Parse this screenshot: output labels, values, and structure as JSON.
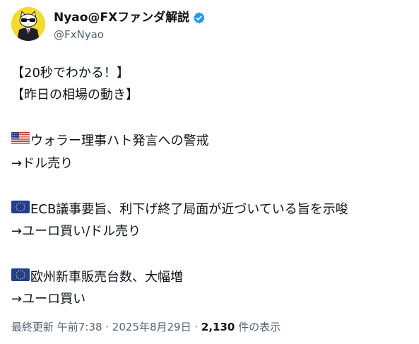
{
  "author": {
    "display_name": "Nyao@FXファンダ解説",
    "handle": "@FxNyao",
    "verified": true
  },
  "post_lines": [
    {
      "flag": "",
      "text": "【20秒でわかる！】"
    },
    {
      "flag": "",
      "text": "【昨日の相場の動き】"
    },
    {
      "flag": "",
      "text": ""
    },
    {
      "flag": "us-flag-icon",
      "text": "ウォラー理事ハト発言への警戒"
    },
    {
      "flag": "",
      "text": "→ドル売り"
    },
    {
      "flag": "",
      "text": ""
    },
    {
      "flag": "eu-flag-icon",
      "text": "ECB議事要旨、利下げ終了局面が近づいている旨を示唆"
    },
    {
      "flag": "",
      "text": "→ユーロ買い/ドル売り"
    },
    {
      "flag": "",
      "text": ""
    },
    {
      "flag": "eu-flag-icon",
      "text": "欧州新車販売台数、大幅増"
    },
    {
      "flag": "",
      "text": "→ユーロ買い"
    }
  ],
  "meta": {
    "updated_label": "最終更新",
    "time": "午前7:38",
    "sep1": " · ",
    "date": "2025年8月29日",
    "sep2": " · ",
    "views_count": "2,130",
    "views_label": " 件の表示"
  },
  "colors": {
    "verified_badge": "#1d9bf0",
    "secondary_text": "#536471",
    "avatar_bg": "#f6dc2a"
  }
}
